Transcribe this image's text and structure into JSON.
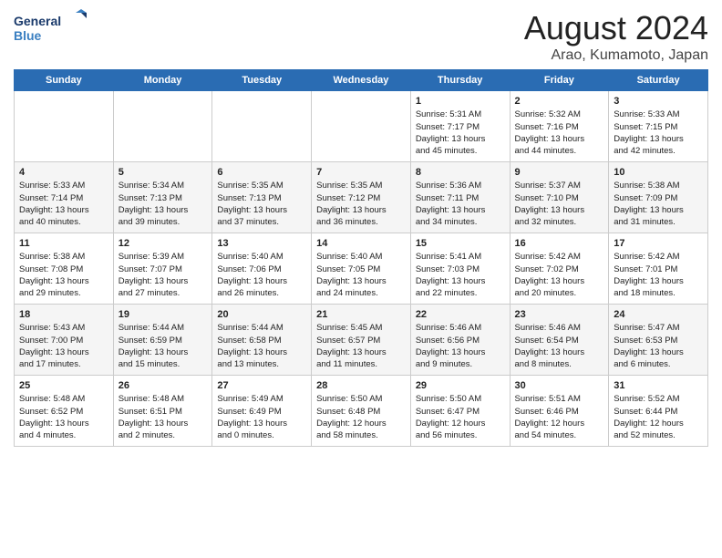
{
  "header": {
    "logo_line1": "General",
    "logo_line2": "Blue",
    "title": "August 2024",
    "subtitle": "Arao, Kumamoto, Japan"
  },
  "weekdays": [
    "Sunday",
    "Monday",
    "Tuesday",
    "Wednesday",
    "Thursday",
    "Friday",
    "Saturday"
  ],
  "weeks": [
    [
      {
        "day": "",
        "info": ""
      },
      {
        "day": "",
        "info": ""
      },
      {
        "day": "",
        "info": ""
      },
      {
        "day": "",
        "info": ""
      },
      {
        "day": "1",
        "info": "Sunrise: 5:31 AM\nSunset: 7:17 PM\nDaylight: 13 hours\nand 45 minutes."
      },
      {
        "day": "2",
        "info": "Sunrise: 5:32 AM\nSunset: 7:16 PM\nDaylight: 13 hours\nand 44 minutes."
      },
      {
        "day": "3",
        "info": "Sunrise: 5:33 AM\nSunset: 7:15 PM\nDaylight: 13 hours\nand 42 minutes."
      }
    ],
    [
      {
        "day": "4",
        "info": "Sunrise: 5:33 AM\nSunset: 7:14 PM\nDaylight: 13 hours\nand 40 minutes."
      },
      {
        "day": "5",
        "info": "Sunrise: 5:34 AM\nSunset: 7:13 PM\nDaylight: 13 hours\nand 39 minutes."
      },
      {
        "day": "6",
        "info": "Sunrise: 5:35 AM\nSunset: 7:13 PM\nDaylight: 13 hours\nand 37 minutes."
      },
      {
        "day": "7",
        "info": "Sunrise: 5:35 AM\nSunset: 7:12 PM\nDaylight: 13 hours\nand 36 minutes."
      },
      {
        "day": "8",
        "info": "Sunrise: 5:36 AM\nSunset: 7:11 PM\nDaylight: 13 hours\nand 34 minutes."
      },
      {
        "day": "9",
        "info": "Sunrise: 5:37 AM\nSunset: 7:10 PM\nDaylight: 13 hours\nand 32 minutes."
      },
      {
        "day": "10",
        "info": "Sunrise: 5:38 AM\nSunset: 7:09 PM\nDaylight: 13 hours\nand 31 minutes."
      }
    ],
    [
      {
        "day": "11",
        "info": "Sunrise: 5:38 AM\nSunset: 7:08 PM\nDaylight: 13 hours\nand 29 minutes."
      },
      {
        "day": "12",
        "info": "Sunrise: 5:39 AM\nSunset: 7:07 PM\nDaylight: 13 hours\nand 27 minutes."
      },
      {
        "day": "13",
        "info": "Sunrise: 5:40 AM\nSunset: 7:06 PM\nDaylight: 13 hours\nand 26 minutes."
      },
      {
        "day": "14",
        "info": "Sunrise: 5:40 AM\nSunset: 7:05 PM\nDaylight: 13 hours\nand 24 minutes."
      },
      {
        "day": "15",
        "info": "Sunrise: 5:41 AM\nSunset: 7:03 PM\nDaylight: 13 hours\nand 22 minutes."
      },
      {
        "day": "16",
        "info": "Sunrise: 5:42 AM\nSunset: 7:02 PM\nDaylight: 13 hours\nand 20 minutes."
      },
      {
        "day": "17",
        "info": "Sunrise: 5:42 AM\nSunset: 7:01 PM\nDaylight: 13 hours\nand 18 minutes."
      }
    ],
    [
      {
        "day": "18",
        "info": "Sunrise: 5:43 AM\nSunset: 7:00 PM\nDaylight: 13 hours\nand 17 minutes."
      },
      {
        "day": "19",
        "info": "Sunrise: 5:44 AM\nSunset: 6:59 PM\nDaylight: 13 hours\nand 15 minutes."
      },
      {
        "day": "20",
        "info": "Sunrise: 5:44 AM\nSunset: 6:58 PM\nDaylight: 13 hours\nand 13 minutes."
      },
      {
        "day": "21",
        "info": "Sunrise: 5:45 AM\nSunset: 6:57 PM\nDaylight: 13 hours\nand 11 minutes."
      },
      {
        "day": "22",
        "info": "Sunrise: 5:46 AM\nSunset: 6:56 PM\nDaylight: 13 hours\nand 9 minutes."
      },
      {
        "day": "23",
        "info": "Sunrise: 5:46 AM\nSunset: 6:54 PM\nDaylight: 13 hours\nand 8 minutes."
      },
      {
        "day": "24",
        "info": "Sunrise: 5:47 AM\nSunset: 6:53 PM\nDaylight: 13 hours\nand 6 minutes."
      }
    ],
    [
      {
        "day": "25",
        "info": "Sunrise: 5:48 AM\nSunset: 6:52 PM\nDaylight: 13 hours\nand 4 minutes."
      },
      {
        "day": "26",
        "info": "Sunrise: 5:48 AM\nSunset: 6:51 PM\nDaylight: 13 hours\nand 2 minutes."
      },
      {
        "day": "27",
        "info": "Sunrise: 5:49 AM\nSunset: 6:49 PM\nDaylight: 13 hours\nand 0 minutes."
      },
      {
        "day": "28",
        "info": "Sunrise: 5:50 AM\nSunset: 6:48 PM\nDaylight: 12 hours\nand 58 minutes."
      },
      {
        "day": "29",
        "info": "Sunrise: 5:50 AM\nSunset: 6:47 PM\nDaylight: 12 hours\nand 56 minutes."
      },
      {
        "day": "30",
        "info": "Sunrise: 5:51 AM\nSunset: 6:46 PM\nDaylight: 12 hours\nand 54 minutes."
      },
      {
        "day": "31",
        "info": "Sunrise: 5:52 AM\nSunset: 6:44 PM\nDaylight: 12 hours\nand 52 minutes."
      }
    ]
  ]
}
